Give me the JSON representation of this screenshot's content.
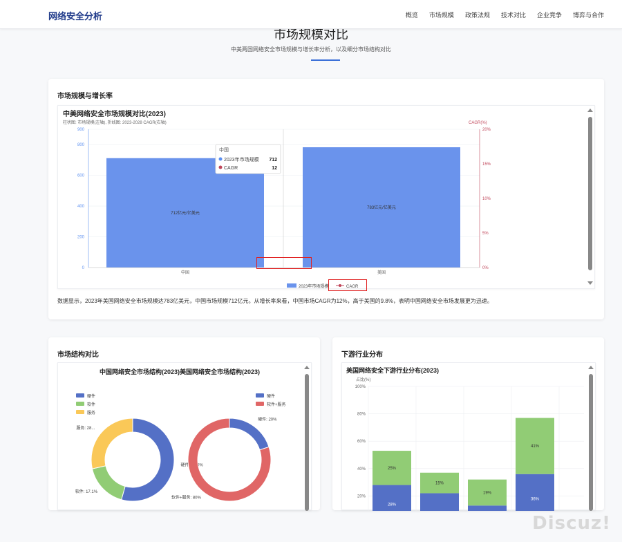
{
  "header": {
    "brand": "网络安全分析",
    "nav": [
      "概览",
      "市场规模",
      "政策法规",
      "技术对比",
      "企业竞争",
      "博弈与合作"
    ]
  },
  "hero": {
    "title": "市场规模对比",
    "subtitle": "中美两国网络安全市场规模与增长率分析，以及细分市场结构对比"
  },
  "section_growth": {
    "title": "市场规模与增长率",
    "description": "数据显示，2023年美国网络安全市场规模达783亿美元，中国市场规模712亿元。从增长率来看，中国市场CAGR为12%，高于美国的9.8%，表明中国网络安全市场发展更为迅速。"
  },
  "section_structure": {
    "title": "市场结构对比"
  },
  "section_downstream": {
    "title": "下游行业分布"
  },
  "tooltip": {
    "title": "中国",
    "rows": [
      {
        "label": "2023年市场规模",
        "value": "712",
        "color": "#5b8ff0"
      },
      {
        "label": "CAGR",
        "value": "12",
        "color": "#c0465a"
      }
    ]
  },
  "watermark": "Discuz!",
  "colors": {
    "bar": "#6a93ec",
    "cagr": "#c0465a",
    "donut_blue": "#5470c6",
    "donut_green": "#91cc75",
    "donut_yellow": "#fac858",
    "donut_red": "#e06666"
  },
  "chart_data": [
    {
      "type": "bar",
      "title": "中美网络安全市场规模对比(2023)",
      "subtitle": "柱状图: 市场规模(左轴), 折线图: 2023-2028 CAGR(右轴)",
      "categories": [
        "中国",
        "美国"
      ],
      "series": [
        {
          "name": "2023年市场规模",
          "values": [
            712,
            783
          ],
          "labels": [
            "712亿元/亿美元",
            "783亿元/亿美元"
          ]
        },
        {
          "name": "CAGR",
          "values": [
            12,
            9.8
          ]
        }
      ],
      "ylim": [
        0,
        900
      ],
      "yticks": [
        "0",
        "200",
        "400",
        "600",
        "800",
        "900"
      ],
      "y2label": "CAGR(%)",
      "y2ticks": [
        "0%",
        "5%",
        "10%",
        "15%",
        "20%"
      ],
      "legend": "bottom"
    },
    {
      "type": "pie",
      "title": "中国网络安全市场结构(2023)",
      "legend": [
        "硬件",
        "软件",
        "服务"
      ],
      "slices": [
        {
          "label": "硬件",
          "value": 54.4,
          "text": "硬件: 54.4%"
        },
        {
          "label": "软件",
          "value": 17.1,
          "text": "软件: 17.1%"
        },
        {
          "label": "服务",
          "value": 28.5,
          "text": "服务: 28..."
        }
      ]
    },
    {
      "type": "pie",
      "title": "美国网络安全市场结构(2023)",
      "legend": [
        "硬件",
        "软件+服务"
      ],
      "slices": [
        {
          "label": "硬件",
          "value": 20,
          "text": "硬件: 20%"
        },
        {
          "label": "软件+服务",
          "value": 80,
          "text": "软件+服务: 80%"
        }
      ]
    },
    {
      "type": "bar",
      "title": "美国网络安全下游行业分布(2023)",
      "ylabel": "占比(%)",
      "yticks": [
        "20%",
        "40%",
        "60%",
        "80%",
        "100%"
      ],
      "stacked": true,
      "series": [
        {
          "name": "blue",
          "values": [
            28,
            22,
            13,
            36
          ],
          "labels": [
            "28%",
            "",
            "",
            "36%"
          ]
        },
        {
          "name": "green",
          "values": [
            25,
            15,
            19,
            41
          ],
          "labels": [
            "25%",
            "15%",
            "19%",
            "41%"
          ]
        }
      ]
    }
  ]
}
